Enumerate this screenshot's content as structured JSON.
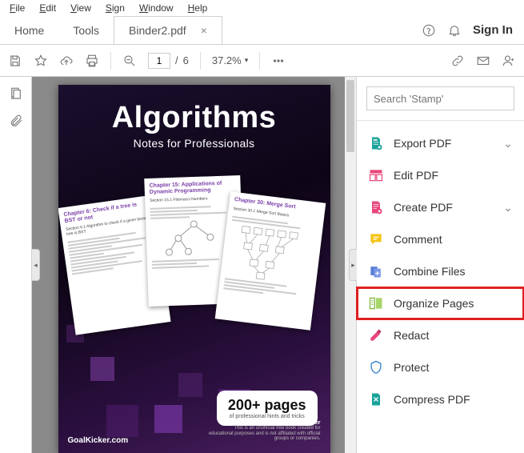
{
  "menu": {
    "file": "File",
    "edit": "Edit",
    "view": "View",
    "sign": "Sign",
    "window": "Window",
    "help": "Help"
  },
  "tabs": {
    "home": "Home",
    "tools": "Tools",
    "doc": "Binder2.pdf"
  },
  "header": {
    "signin": "Sign In"
  },
  "toolbar": {
    "page_current": "1",
    "page_sep": "/",
    "page_total": "6",
    "zoom": "37.2%"
  },
  "rightpanel": {
    "search_placeholder": "Search 'Stamp'",
    "items": [
      {
        "label": "Export PDF",
        "expandable": true
      },
      {
        "label": "Edit PDF",
        "expandable": false
      },
      {
        "label": "Create PDF",
        "expandable": true
      },
      {
        "label": "Comment",
        "expandable": false
      },
      {
        "label": "Combine Files",
        "expandable": false
      },
      {
        "label": "Organize Pages",
        "expandable": false,
        "highlight": true
      },
      {
        "label": "Redact",
        "expandable": false
      },
      {
        "label": "Protect",
        "expandable": false
      },
      {
        "label": "Compress PDF",
        "expandable": false
      }
    ]
  },
  "page": {
    "title": "Algorithms",
    "subtitle": "Notes for Professionals",
    "sheets": [
      {
        "title": "Chapter 6: Check if a tree is BST or not",
        "sub": "Section 6.1 Algorithm to check if a given binary tree is BST"
      },
      {
        "title": "Chapter 15: Applications of Dynamic Programming",
        "sub": "Section 15.1 Fibonacci Numbers"
      },
      {
        "title": "Chapter 30: Merge Sort",
        "sub": "Section 30.1 Merge Sort Basics"
      }
    ],
    "badge_big": "200+ pages",
    "badge_small": "of professional hints and tricks",
    "footer": "GoalKicker.com",
    "disclaimer_head": "Disclaimer",
    "disclaimer_body": "This is an unofficial free book created for educational purposes and is not affiliated with official groups or companies."
  }
}
